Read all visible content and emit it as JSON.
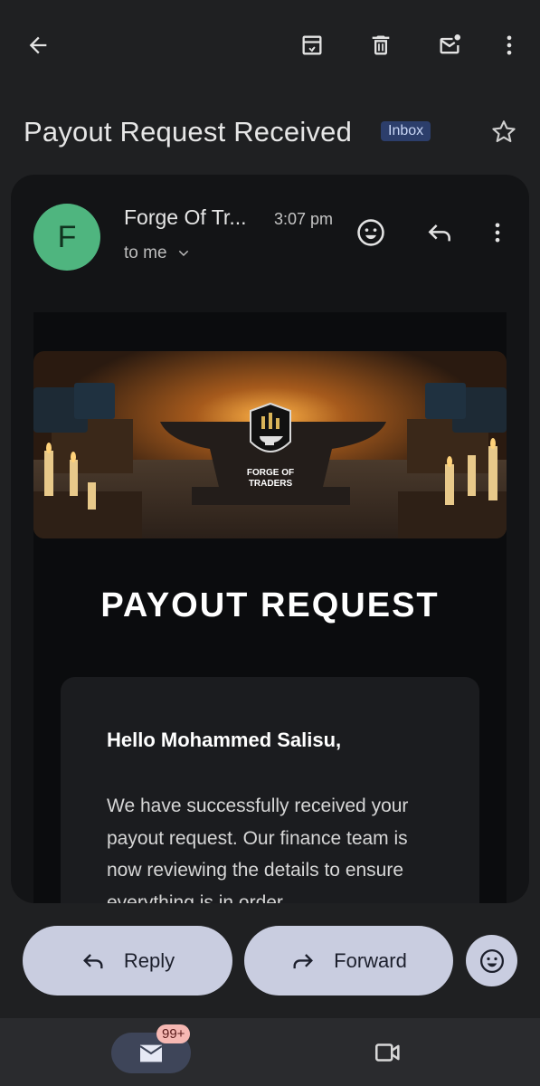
{
  "toolbar": {
    "back": "arrow-back-icon",
    "archive": "archive-icon",
    "delete": "trash-icon",
    "mark_unread": "mark-unread-icon",
    "more": "more-vert-icon"
  },
  "email": {
    "subject": "Payout Request Received",
    "label": "Inbox",
    "sender_initial": "F",
    "sender": "Forge Of Tr...",
    "time": "3:07 pm",
    "recipient": "to me"
  },
  "body": {
    "logo_line1": "FORGE OF",
    "logo_line2": "TRADERS",
    "headline": "PAYOUT REQUEST",
    "greeting": "Hello Mohammed Salisu,",
    "message": "We have successfully received your payout request. Our finance team is now reviewing the details to ensure everything is in order."
  },
  "actions": {
    "reply": "Reply",
    "forward": "Forward"
  },
  "nav": {
    "mail_badge": "99+"
  },
  "colors": {
    "background": "#1f2022",
    "card": "#131416",
    "avatar": "#4fb57f",
    "pill": "#c9cde0",
    "badge": "#f6b8b3",
    "label_bg": "#2c3e6b"
  }
}
